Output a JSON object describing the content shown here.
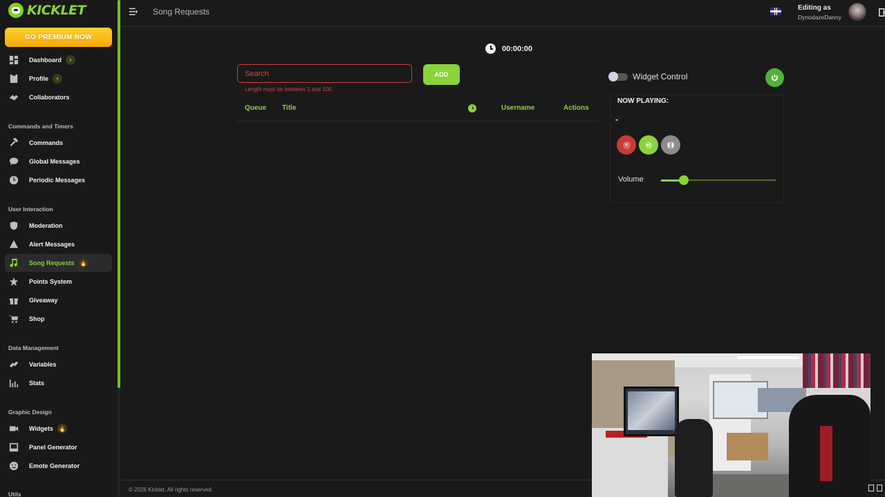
{
  "brand": {
    "name": "KICKLET",
    "color": "#8ad33a"
  },
  "sidebar": {
    "premium_label": "GO PREMIUM NOW",
    "items_top": [
      {
        "label": "Dashboard",
        "icon": "dashboard-icon",
        "badge": "bolt-badge"
      },
      {
        "label": "Profile",
        "icon": "profile-icon",
        "badge": "bolt-badge"
      },
      {
        "label": "Collaborators",
        "icon": "handshake-icon"
      }
    ],
    "section_commands": "Commands and Timers",
    "items_commands": [
      {
        "label": "Commands",
        "icon": "hammer-icon"
      },
      {
        "label": "Global Messages",
        "icon": "chat-bubble-icon"
      },
      {
        "label": "Periodic Messages",
        "icon": "clock-icon"
      }
    ],
    "section_interaction": "User Interaction",
    "items_interaction": [
      {
        "label": "Moderation",
        "icon": "shield-icon"
      },
      {
        "label": "Alert Messages",
        "icon": "warning-icon"
      },
      {
        "label": "Song Requests",
        "icon": "music-note-icon",
        "badge": "fire-badge",
        "active": true
      },
      {
        "label": "Points System",
        "icon": "star-icon"
      },
      {
        "label": "Giveaway",
        "icon": "gift-icon"
      },
      {
        "label": "Shop",
        "icon": "cart-icon"
      }
    ],
    "section_data": "Data Management",
    "items_data": [
      {
        "label": "Variables",
        "icon": "link-icon"
      },
      {
        "label": "Stats",
        "icon": "bar-chart-icon"
      }
    ],
    "section_graphic": "Graphic Design",
    "items_graphic": [
      {
        "label": "Widgets",
        "icon": "camera-icon",
        "badge": "fire-badge"
      },
      {
        "label": "Panel Generator",
        "icon": "panel-icon"
      },
      {
        "label": "Emote Generator",
        "icon": "smiley-icon"
      }
    ],
    "section_utils": "Utils"
  },
  "header": {
    "page_title": "Song Requests",
    "editing_label": "Editing as",
    "editing_user": "DynodazeDanny",
    "language": "flag-uk-icon"
  },
  "player": {
    "timer": "00:00:00",
    "search_placeholder": "Search",
    "search_error": "Length must be between 1 and 100",
    "add_label": "ADD",
    "columns": [
      "Queue",
      "Title",
      "Username",
      "Actions"
    ],
    "widget_control_label": "Widget Control",
    "widget_control_on": false,
    "now_playing_label": "NOW PLAYING:",
    "now_playing_title": "-",
    "volume_label": "Volume",
    "volume_level": 0.2
  },
  "footer": {
    "copyright": "© 2026 Kicklet. All rights reserved."
  },
  "colors": {
    "accent": "#8ad33a",
    "danger": "#c93a3a",
    "premium": "#f5a80b",
    "background": "#1a1a1a"
  }
}
